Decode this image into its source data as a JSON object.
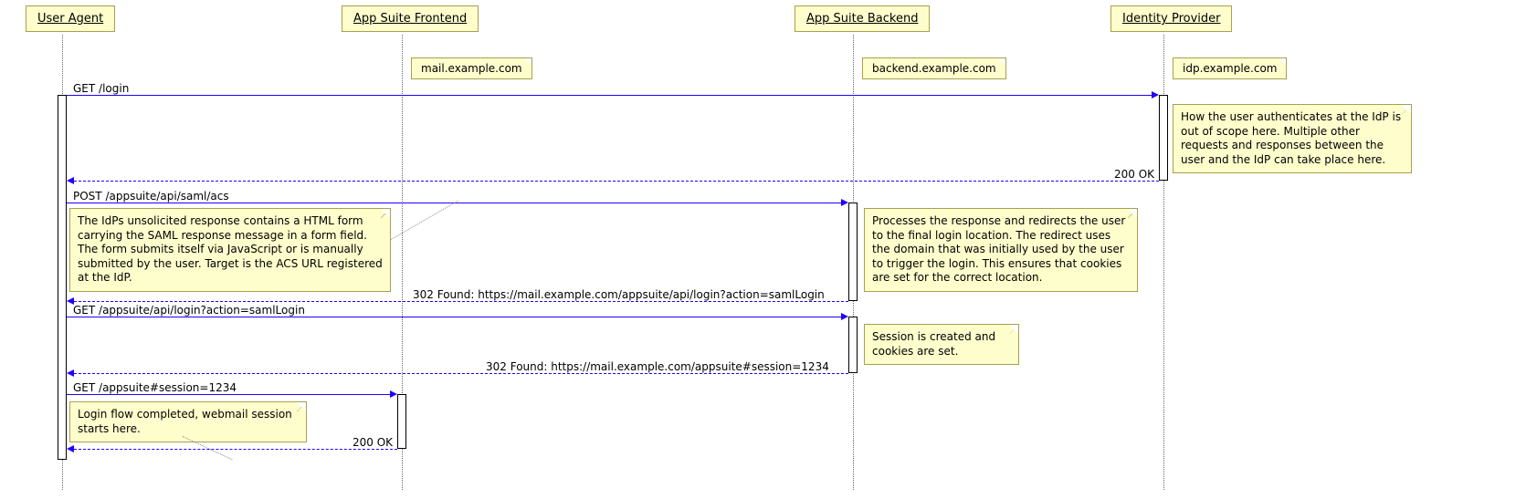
{
  "participants": {
    "user_agent": "User Agent",
    "frontend": "App Suite Frontend",
    "backend": "App Suite Backend",
    "idp": "Identity Provider"
  },
  "captions": {
    "frontend": "mail.example.com",
    "backend": "backend.example.com",
    "idp": "idp.example.com"
  },
  "messages": {
    "m1": "GET /login",
    "m2": "200 OK",
    "m3": "POST /appsuite/api/saml/acs",
    "m4": "302 Found: https://mail.example.com/appsuite/api/login?action=samlLogin",
    "m5": "GET /appsuite/api/login?action=samlLogin",
    "m6": "302 Found: https://mail.example.com/appsuite#session=1234",
    "m7": "GET /appsuite#session=1234",
    "m8": "200 OK"
  },
  "notes": {
    "n_idp": "How the user authenticates at the IdP is out of scope here. Multiple other requests and responses between the user and the IdP can take place here.",
    "n_acs": "The IdPs unsolicited response contains a HTML form carrying the SAML response message in a form field. The form submits itself via JavaScript or is manually submitted by the user. Target is the ACS URL registered at the IdP.",
    "n_backend1": "Processes the response and redirects the user to the final login location. The redirect uses the domain that was initially used by the user to trigger the login. This ensures that cookies are set for the correct location.",
    "n_backend2": "Session is created and cookies are set.",
    "n_frontend": "Login flow completed, webmail session starts here."
  },
  "chart_data": {
    "type": "sequence-diagram",
    "participants": [
      {
        "id": "user_agent",
        "name": "User Agent"
      },
      {
        "id": "frontend",
        "name": "App Suite Frontend",
        "host": "mail.example.com"
      },
      {
        "id": "backend",
        "name": "App Suite Backend",
        "host": "backend.example.com"
      },
      {
        "id": "idp",
        "name": "Identity Provider",
        "host": "idp.example.com"
      }
    ],
    "messages": [
      {
        "from": "user_agent",
        "to": "idp",
        "type": "request",
        "label": "GET /login"
      },
      {
        "from": "idp",
        "to": "user_agent",
        "type": "response",
        "label": "200 OK",
        "note_at": "idp",
        "note": "How the user authenticates at the IdP is out of scope here. Multiple other requests and responses between the user and the IdP can take place here."
      },
      {
        "from": "user_agent",
        "to": "backend",
        "type": "request",
        "label": "POST /appsuite/api/saml/acs",
        "note_at": "user_agent",
        "note": "The IdPs unsolicited response contains a HTML form carrying the SAML response message in a form field. The form submits itself via JavaScript or is manually submitted by the user. Target is the ACS URL registered at the IdP."
      },
      {
        "from": "backend",
        "to": "user_agent",
        "type": "response",
        "label": "302 Found: https://mail.example.com/appsuite/api/login?action=samlLogin",
        "note_at": "backend",
        "note": "Processes the response and redirects the user to the final login location. The redirect uses the domain that was initially used by the user to trigger the login. This ensures that cookies are set for the correct location."
      },
      {
        "from": "user_agent",
        "to": "backend",
        "type": "request",
        "label": "GET /appsuite/api/login?action=samlLogin"
      },
      {
        "from": "backend",
        "to": "user_agent",
        "type": "response",
        "label": "302 Found: https://mail.example.com/appsuite#session=1234",
        "note_at": "backend",
        "note": "Session is created and cookies are set."
      },
      {
        "from": "user_agent",
        "to": "frontend",
        "type": "request",
        "label": "GET /appsuite#session=1234"
      },
      {
        "from": "frontend",
        "to": "user_agent",
        "type": "response",
        "label": "200 OK",
        "note_at": "frontend",
        "note": "Login flow completed, webmail session starts here."
      }
    ]
  }
}
